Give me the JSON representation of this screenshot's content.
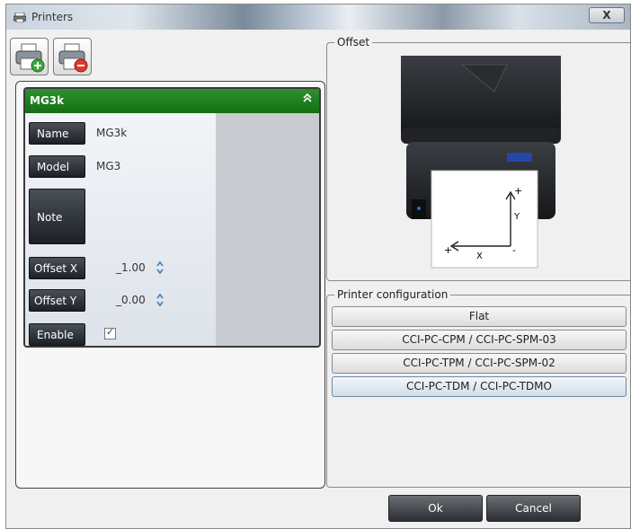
{
  "window": {
    "title": "Printers",
    "close_label": "X"
  },
  "toolbar": {
    "add_icon": "printer-add-icon",
    "remove_icon": "printer-remove-icon"
  },
  "printer_card": {
    "header": "MG3k",
    "collapse_glyph": "»",
    "name_label": "Name",
    "name_value": "MG3k",
    "model_label": "Model",
    "model_value": "MG3",
    "note_label": "Note",
    "note_value": "",
    "offset_x_label": "Offset X",
    "offset_x_value": "_1.00",
    "offset_y_label": "Offset Y",
    "offset_y_value": "_0.00",
    "enable_label": "Enable",
    "enable_checked": true,
    "enable_check_glyph": "✓",
    "header_color": "#1e7d1e"
  },
  "offset_panel": {
    "label": "Offset",
    "diagram": {
      "plus_top": "+",
      "y_axis": "Y",
      "minus_bottom": "-",
      "plus_left": "+",
      "x_axis": "X"
    }
  },
  "config_panel": {
    "label": "Printer configuration",
    "options": [
      "Flat",
      "CCI-PC-CPM / CCI-PC-SPM-03",
      "CCI-PC-TPM / CCI-PC-SPM-02",
      "CCI-PC-TDM / CCI-PC-TDMO"
    ],
    "selected_index": 3
  },
  "buttons": {
    "ok": "Ok",
    "cancel": "Cancel"
  }
}
